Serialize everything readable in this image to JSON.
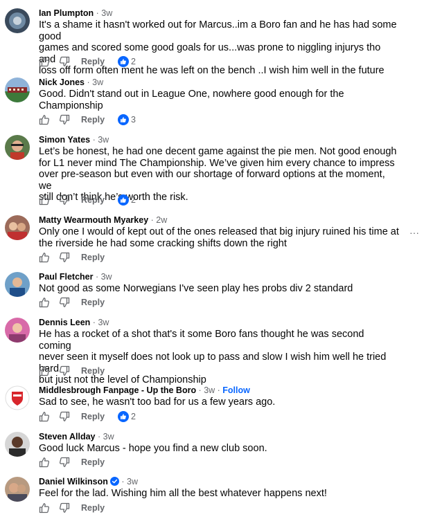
{
  "comments": [
    {
      "name": "Ian Plumpton",
      "time": "3w",
      "text": "It's a shame it hasn't worked out for Marcus..im a Boro fan and he has had some good\ngames and scored some good goals for us...was prone to niggling injurys tho and\nloss off form often ment he was left on the bench ..I wish him well in the future",
      "reply": "Reply",
      "likes": "2"
    },
    {
      "name": "Nick Jones",
      "time": "3w",
      "text": "Good. Didn't stand out in League One, nowhere good enough for the\nChampionship",
      "reply": "Reply",
      "likes": "3"
    },
    {
      "name": "Simon Yates",
      "time": "3w",
      "text": "Let’s be honest, he had one decent game against the pie men. Not good enough\nfor L1 never mind The Championship. We’ve given him every chance to impress\nover pre-season but even with our shortage of forward options at the moment, we\nstill don’t think he’s worth the risk.",
      "reply": "Reply",
      "likes": "2"
    },
    {
      "name": "Matty Wearmouth Myarkey",
      "time": "2w",
      "text": "Only one I would of kept out of the ones released that big injury ruined his time at\nthe riverside he had some cracking shifts down the right",
      "reply": "Reply",
      "likes": ""
    },
    {
      "name": "Paul Fletcher",
      "time": "3w",
      "text": "Not good as some Norwegians I've seen play hes probs div 2 standard",
      "reply": "Reply",
      "likes": ""
    },
    {
      "name": "Dennis Leen",
      "time": "3w",
      "text": "He has a rocket of a shot that's it some Boro fans thought he was second coming\nnever seen it myself does not look up to pass and slow I wish him well he tried hard\nbut just not the level of Championship",
      "reply": "Reply",
      "likes": ""
    },
    {
      "name": "Middlesbrough Fanpage - Up the Boro",
      "time": "3w",
      "follow": "Follow",
      "text": "Sad to see, he wasn't too bad for us a few years ago.",
      "reply": "Reply",
      "likes": "2"
    },
    {
      "name": "Steven Allday",
      "time": "3w",
      "text": "Good luck Marcus - hope you find a new club soon.",
      "reply": "Reply",
      "likes": ""
    },
    {
      "name": "Daniel Wilkinson",
      "time": "3w",
      "text": "Feel for the lad. Wishing him all the best whatever happens next!",
      "reply": "Reply",
      "likes": ""
    }
  ],
  "icons": {
    "like": "thumbs-up-outline-icon",
    "dislike": "thumbs-down-outline-icon",
    "reaction": "like-reaction-icon",
    "more": "more-options-icon",
    "verified": "verified-badge-icon"
  },
  "colors": {
    "accent": "#0866ff",
    "secondary_text": "#65676b",
    "text": "#050505"
  }
}
